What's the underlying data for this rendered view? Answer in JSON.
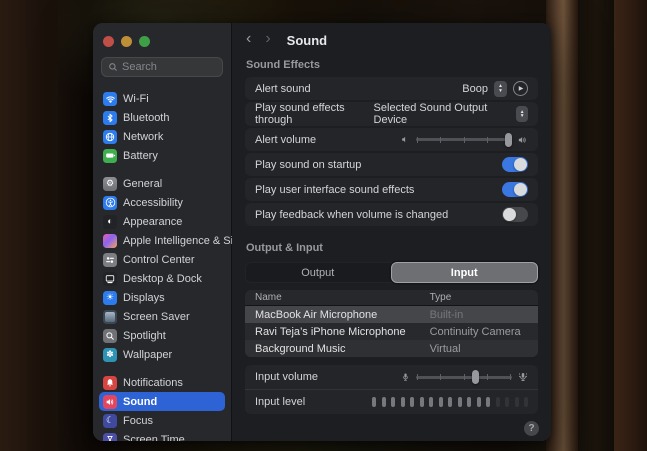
{
  "window": {
    "search": {
      "placeholder": "Search"
    },
    "nav": {
      "back": "‹",
      "forward": "›",
      "title": "Sound"
    },
    "sidebar": {
      "items": [
        {
          "label": "Wi-Fi"
        },
        {
          "label": "Bluetooth"
        },
        {
          "label": "Network"
        },
        {
          "label": "Battery"
        },
        {
          "label": "General"
        },
        {
          "label": "Accessibility"
        },
        {
          "label": "Appearance"
        },
        {
          "label": "Apple Intelligence & Siri"
        },
        {
          "label": "Control Center"
        },
        {
          "label": "Desktop & Dock"
        },
        {
          "label": "Displays"
        },
        {
          "label": "Screen Saver"
        },
        {
          "label": "Spotlight"
        },
        {
          "label": "Wallpaper"
        },
        {
          "label": "Notifications"
        },
        {
          "label": "Sound"
        },
        {
          "label": "Focus"
        },
        {
          "label": "Screen Time"
        }
      ],
      "selected": "Sound"
    },
    "sound_effects": {
      "heading": "Sound Effects",
      "alert_sound": {
        "label": "Alert sound",
        "value": "Boop"
      },
      "play_through": {
        "label": "Play sound effects through",
        "value": "Selected Sound Output Device"
      },
      "alert_volume": {
        "label": "Alert volume",
        "value_percent": 100
      },
      "startup": {
        "label": "Play sound on startup",
        "on": true
      },
      "ui_effects": {
        "label": "Play user interface sound effects",
        "on": true
      },
      "feedback": {
        "label": "Play feedback when volume is changed",
        "on": false
      }
    },
    "output_input": {
      "heading": "Output & Input",
      "tabs": [
        {
          "label": "Output",
          "selected": false
        },
        {
          "label": "Input",
          "selected": true
        }
      ],
      "table": {
        "columns": [
          "Name",
          "Type"
        ],
        "rows": [
          {
            "name": "MacBook Air Microphone",
            "type": "Built-in",
            "selected": true
          },
          {
            "name": "Ravi Teja’s iPhone Microphone",
            "type": "Continuity Camera",
            "selected": false
          },
          {
            "name": "Background Music",
            "type": "Virtual",
            "selected": false
          }
        ]
      },
      "input_volume": {
        "label": "Input volume",
        "value_percent": 62
      },
      "input_level": {
        "label": "Input level",
        "segments_total": 17,
        "segments_lit": 13
      }
    },
    "help_label": "?"
  },
  "colors": {
    "accent": "#2e63d6",
    "toggle_on": "#3a77e0",
    "sound_icon": "#e3475f"
  }
}
